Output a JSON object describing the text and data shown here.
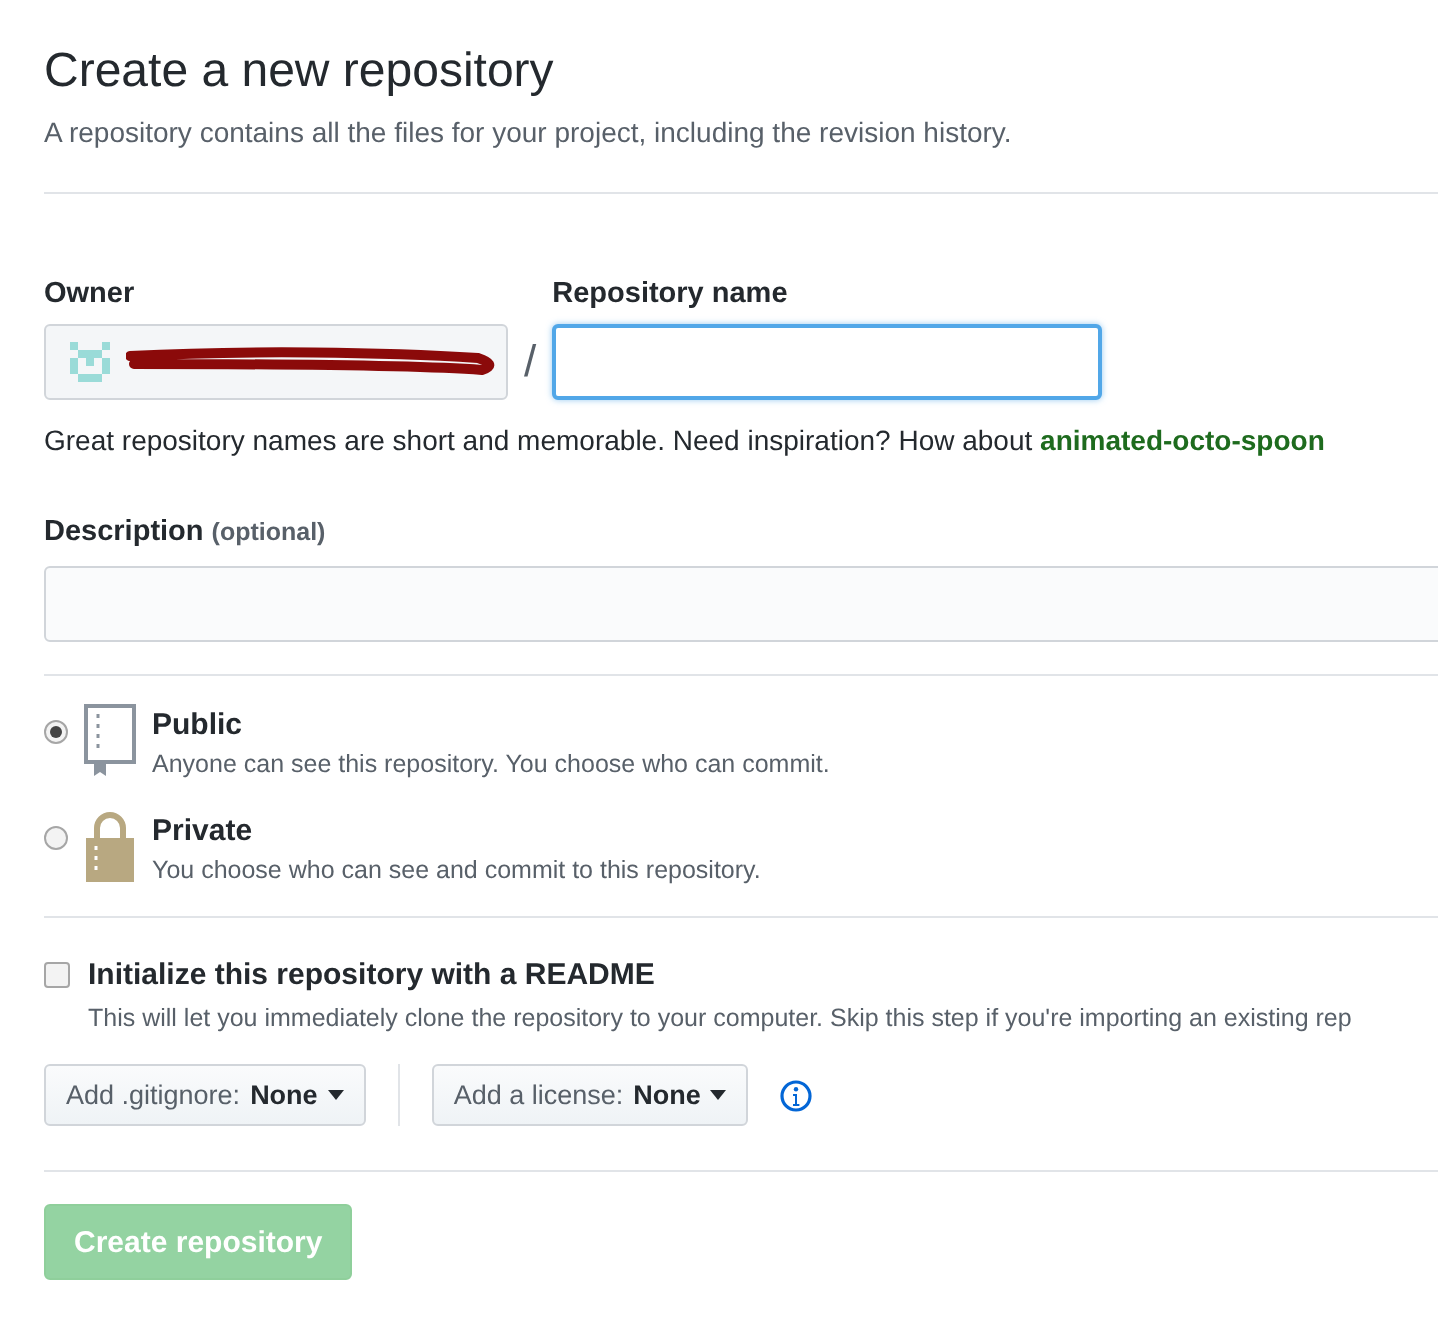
{
  "header": {
    "title": "Create a new repository",
    "subtitle": "A repository contains all the files for your project, including the revision history."
  },
  "owner": {
    "label": "Owner",
    "redacted": true
  },
  "separator": "/",
  "repository_name": {
    "label": "Repository name",
    "focused": true
  },
  "name_hint": {
    "text": "Great repository names are short and memorable. Need inspiration? How about ",
    "suggestion": "animated-octo-spoon"
  },
  "description": {
    "label": "Description",
    "qualifier": "(optional)"
  },
  "visibility": [
    {
      "kind": "book",
      "label": "Public",
      "note": "Anyone can see this repository. You choose who can commit.",
      "selected": true
    },
    {
      "kind": "lock",
      "label": "Private",
      "note": "You choose who can see and commit to this repository.",
      "selected": false
    }
  ],
  "readme": {
    "label": "Initialize this repository with a README",
    "note": "This will let you immediately clone the repository to your computer. Skip this step if you're importing an existing rep",
    "checked": false
  },
  "dropdowns": [
    {
      "label": "Add .gitignore:",
      "value": "None"
    },
    {
      "label": "Add a license:",
      "value": "None"
    }
  ],
  "submit": {
    "label": "Create repository",
    "disabled": true
  }
}
